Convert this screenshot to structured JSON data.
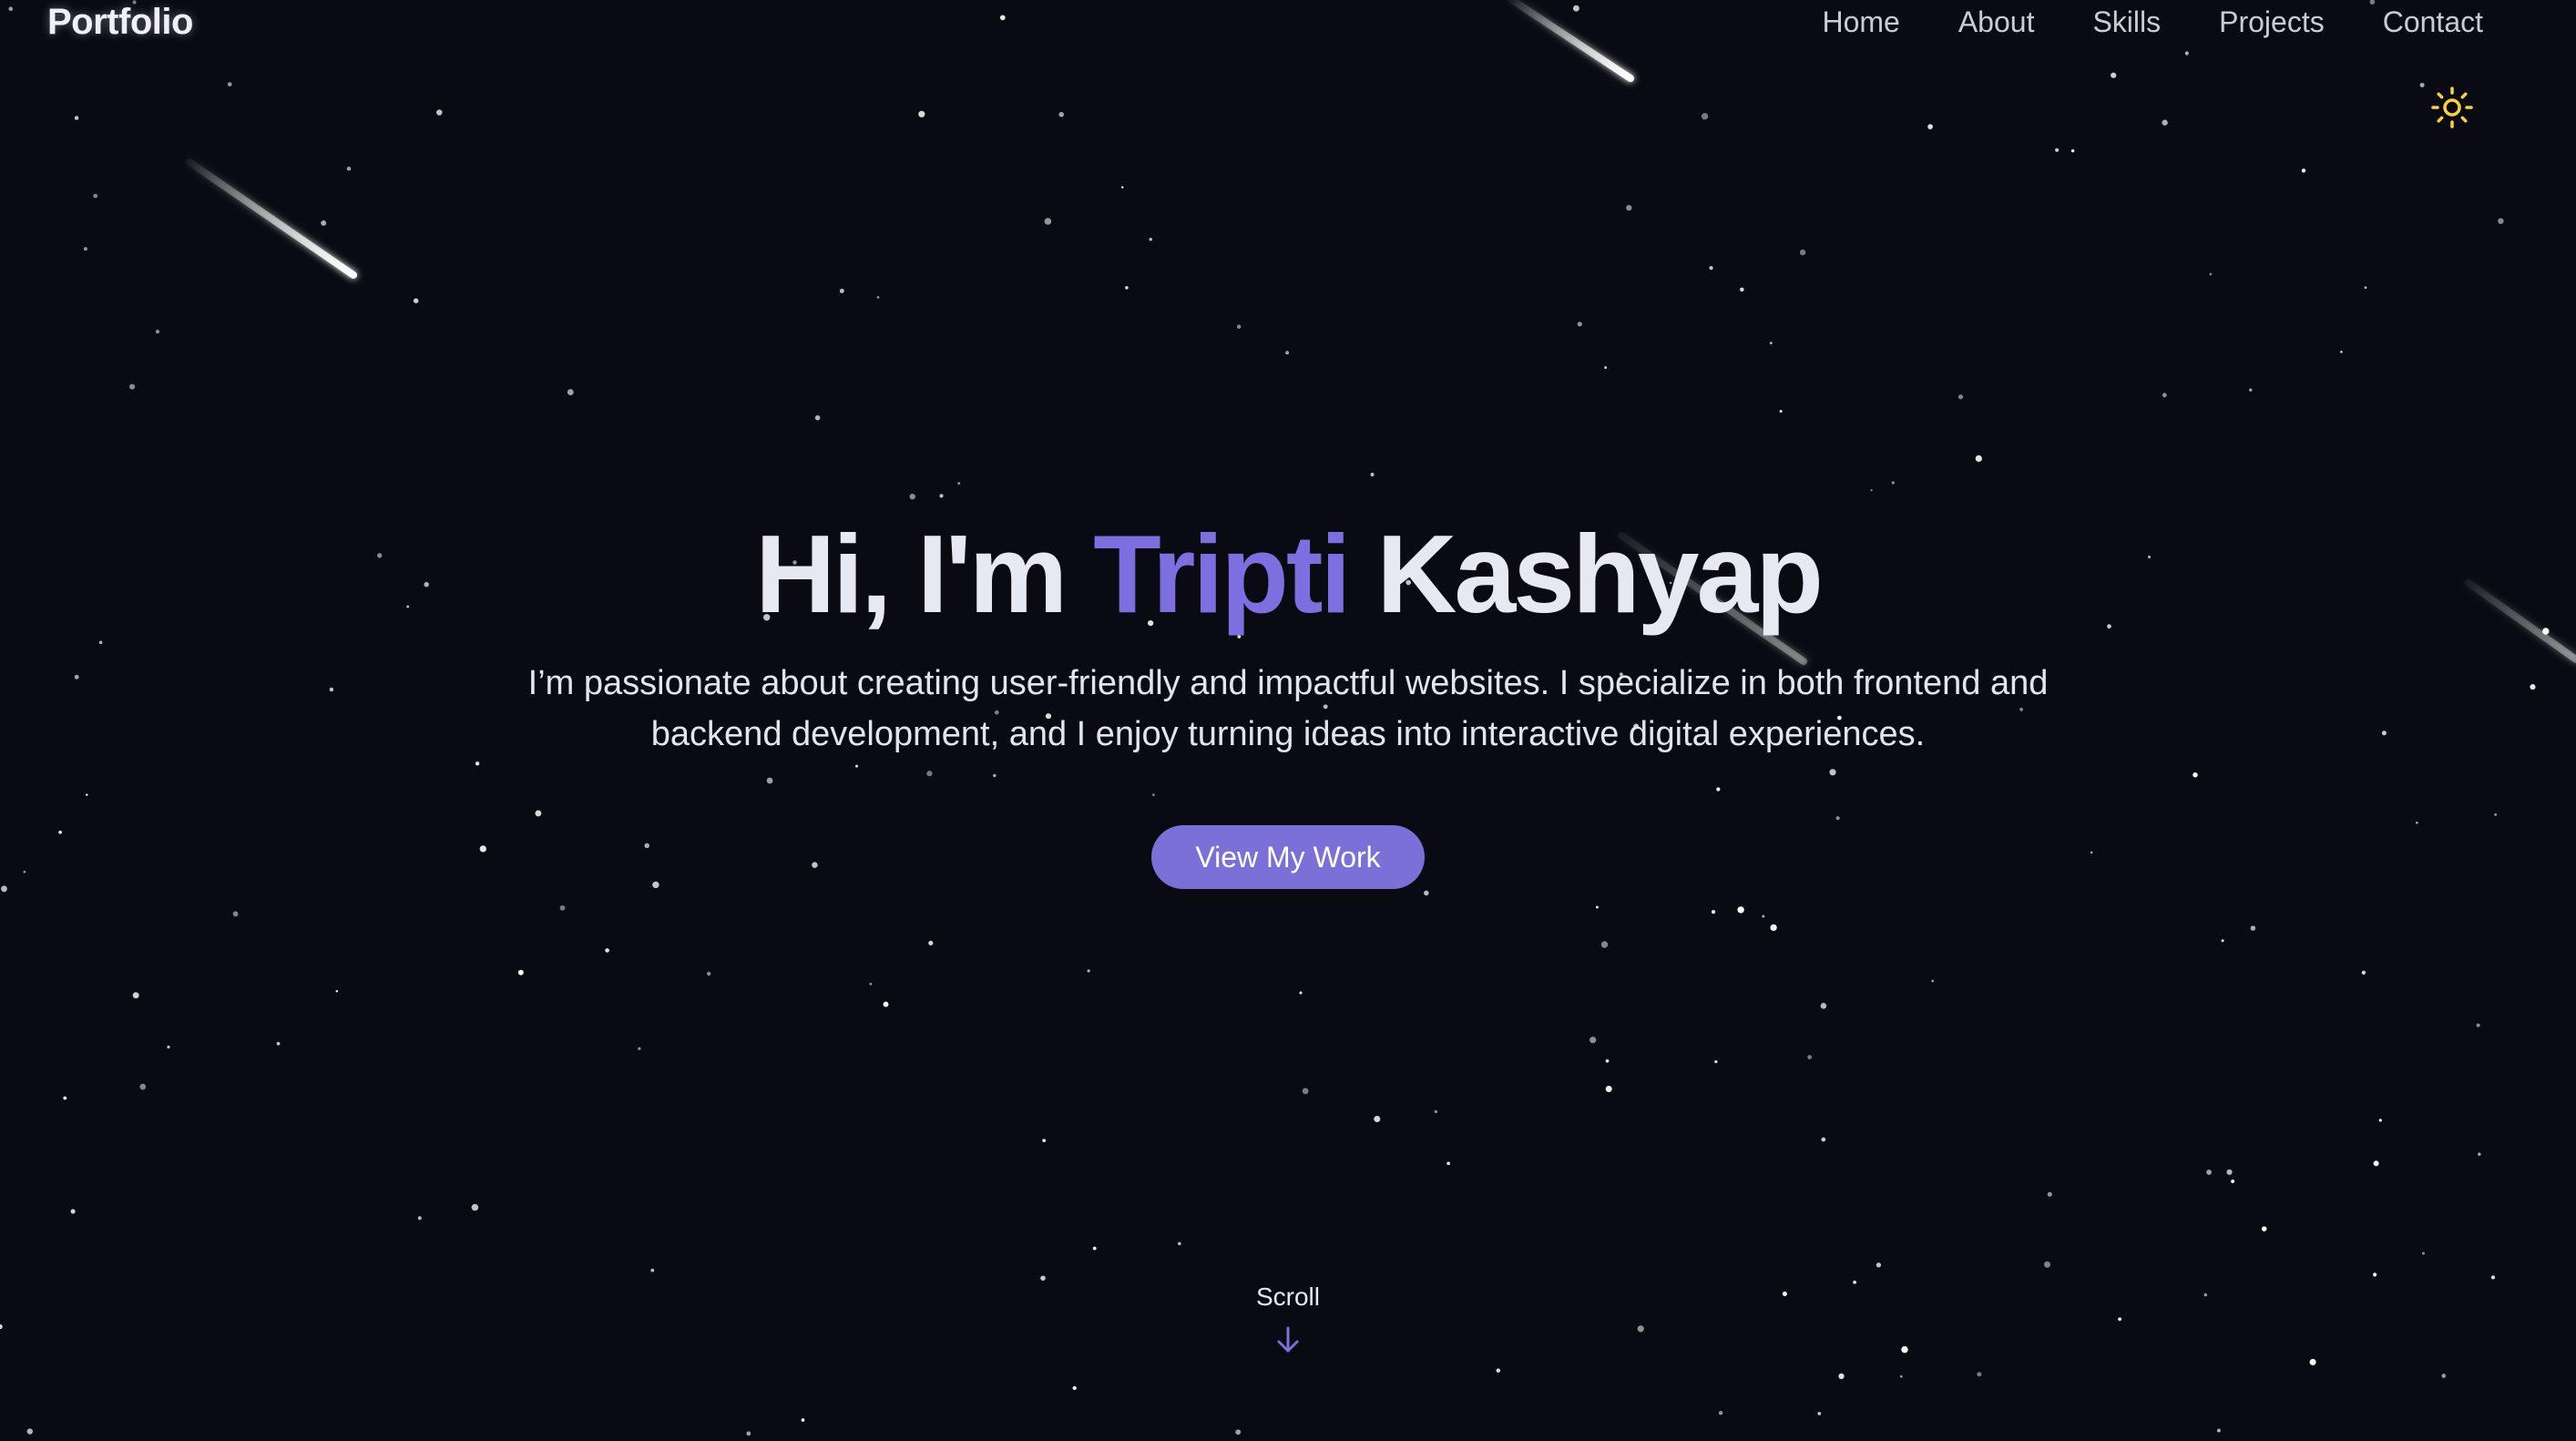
{
  "header": {
    "logo": "Portfolio",
    "nav": [
      "Home",
      "About",
      "Skills",
      "Projects",
      "Contact"
    ],
    "theme_toggle_icon": "sun-icon"
  },
  "hero": {
    "greeting": "Hi, I'm",
    "first_name": "Tripti",
    "last_name": "Kashyap",
    "subtitle": "I’m passionate about creating user-friendly and impactful websites. I specialize in both frontend and backend development, and I enjoy turning ideas into interactive digital experiences.",
    "cta_label": "View My Work"
  },
  "scroll": {
    "label": "Scroll",
    "icon": "arrow-down-icon"
  },
  "colors": {
    "background": "#0a0b12",
    "accent": "#7e6fe0",
    "button": "#7b6fd8",
    "sun": "#f5d33a"
  }
}
